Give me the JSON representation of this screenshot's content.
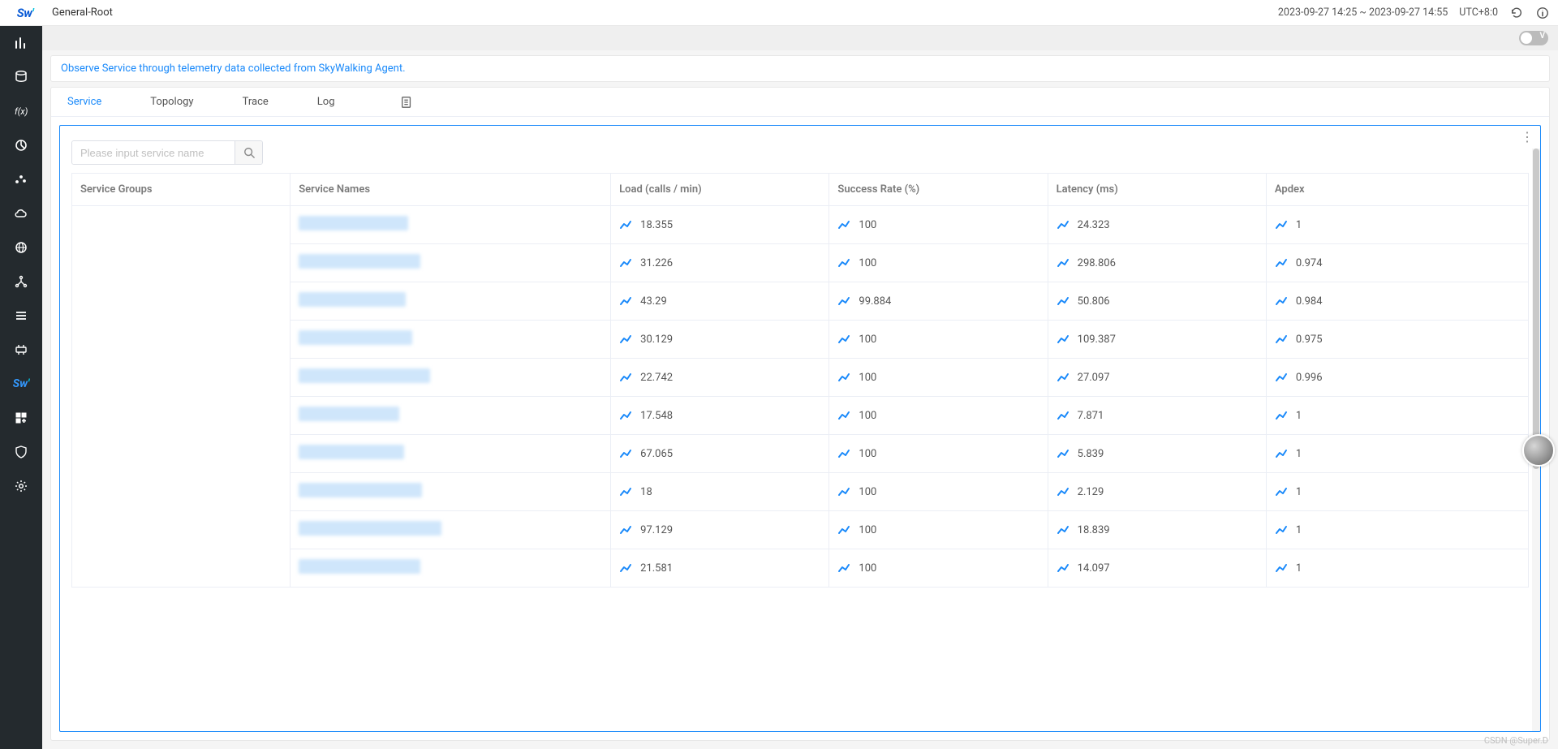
{
  "header": {
    "title": "General-Root",
    "time_range": "2023-09-27 14:25 ~ 2023-09-27 14:55",
    "timezone": "UTC+8:0"
  },
  "banner_text": "Observe Service through telemetry data collected from SkyWalking Agent.",
  "view_toggle_label": "V",
  "tabs": {
    "service": "Service",
    "topology": "Topology",
    "trace": "Trace",
    "log": "Log"
  },
  "search": {
    "placeholder": "Please input service name"
  },
  "columns": {
    "group": "Service Groups",
    "name": "Service Names",
    "load": "Load (calls / min)",
    "rate": "Success Rate (%)",
    "latency": "Latency (ms)",
    "apdex": "Apdex"
  },
  "rows": [
    {
      "name_redact_w": 135,
      "load": "18.355",
      "rate": "100",
      "latency": "24.323",
      "apdex": "1"
    },
    {
      "name_redact_w": 150,
      "load": "31.226",
      "rate": "100",
      "latency": "298.806",
      "apdex": "0.974"
    },
    {
      "name_redact_w": 132,
      "load": "43.29",
      "rate": "99.884",
      "latency": "50.806",
      "apdex": "0.984"
    },
    {
      "name_redact_w": 140,
      "load": "30.129",
      "rate": "100",
      "latency": "109.387",
      "apdex": "0.975"
    },
    {
      "name_redact_w": 162,
      "load": "22.742",
      "rate": "100",
      "latency": "27.097",
      "apdex": "0.996"
    },
    {
      "name_redact_w": 124,
      "load": "17.548",
      "rate": "100",
      "latency": "7.871",
      "apdex": "1"
    },
    {
      "name_redact_w": 130,
      "load": "67.065",
      "rate": "100",
      "latency": "5.839",
      "apdex": "1"
    },
    {
      "name_redact_w": 152,
      "load": "18",
      "rate": "100",
      "latency": "2.129",
      "apdex": "1"
    },
    {
      "name_redact_w": 176,
      "load": "97.129",
      "rate": "100",
      "latency": "18.839",
      "apdex": "1"
    },
    {
      "name_redact_w": 150,
      "load": "21.581",
      "rate": "100",
      "latency": "14.097",
      "apdex": "1"
    }
  ],
  "sidebar_icons": [
    "chart-icon",
    "database-icon",
    "function-icon",
    "pie-icon",
    "scatter-icon",
    "cloud-icon",
    "globe-icon",
    "branch-icon",
    "list-icon",
    "infra-icon",
    "brand-icon",
    "grid-add-icon",
    "shield-icon",
    "gear-icon"
  ],
  "watermark": "CSDN @Super.D"
}
